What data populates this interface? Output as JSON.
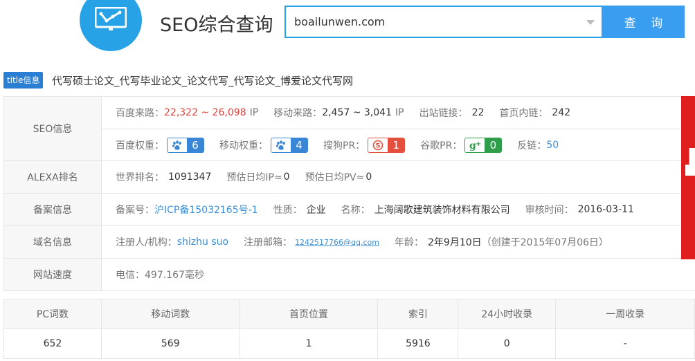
{
  "header": {
    "title": "SEO综合查询",
    "search_value": "boailunwen.com",
    "search_button": "查 询"
  },
  "title_line": {
    "badge": "title信息",
    "text": "代写硕士论文_代写毕业论文_论文代写_代写论文_博爱论文代写网"
  },
  "seo": {
    "label": "SEO信息",
    "baidu_traffic_label": "百度来路：",
    "baidu_traffic_value": "22,322 ~ 26,098",
    "baidu_traffic_unit": "IP",
    "mobile_traffic_label": "移动来路：",
    "mobile_traffic_value": "2,457 ~ 3,041",
    "mobile_traffic_unit": "IP",
    "outbound_label": "出站链接：",
    "outbound_value": "22",
    "inlinks_label": "首页内链：",
    "inlinks_value": "242",
    "baidu_weight_label": "百度权重：",
    "baidu_weight_value": "6",
    "mobile_weight_label": "移动权重：",
    "mobile_weight_value": "4",
    "sogou_pr_label": "搜狗PR：",
    "sogou_pr_value": "1",
    "google_pr_label": "谷歌PR：",
    "google_pr_value": "0",
    "backlinks_label": "反链：",
    "backlinks_value": "50"
  },
  "alexa": {
    "label": "ALEXA排名",
    "world_rank_label": "世界排名：",
    "world_rank_value": "1091347",
    "daily_ip_label": "预估日均IP≈",
    "daily_ip_value": "0",
    "daily_pv_label": "预估日均PV≈",
    "daily_pv_value": "0"
  },
  "icp": {
    "label": "备案信息",
    "number_label": "备案号：",
    "number_value": "沪ICP备15032165号-1",
    "nature_label": "性质：",
    "nature_value": "企业",
    "name_label": "名称：",
    "name_value": "上海阔歌建筑装饰材料有限公司",
    "audit_label": "审核时间：",
    "audit_value": "2016-03-11"
  },
  "domain": {
    "label": "域名信息",
    "registrant_label": "注册人/机构：",
    "registrant_value": "shizhu suo",
    "email_label": "注册邮箱：",
    "email_value": "1242517766@qq.com",
    "age_label": "年龄：",
    "age_value": "2年9月10日",
    "created_value": "（创建于2015年07月06日）"
  },
  "speed": {
    "label": "网站速度",
    "value": "电信：497.167毫秒"
  },
  "stats": {
    "headers": [
      "PC词数",
      "移动词数",
      "首页位置",
      "索引",
      "24小时收录",
      "一周收录"
    ],
    "values": [
      "652",
      "569",
      "1",
      "5916",
      "0",
      "-"
    ]
  },
  "colors": {
    "accent": "#28a2e6",
    "traffic_red": "#e0403a",
    "link_blue": "#3a8fd6",
    "baidu_blue": "#3a86d6",
    "sogou_red": "#e4503d",
    "google_green": "#2e9e4a"
  },
  "icons": [
    "chart-logo-icon",
    "chevron-down-icon",
    "baidu-paw-icon",
    "sogou-icon",
    "google-plus-icon"
  ]
}
